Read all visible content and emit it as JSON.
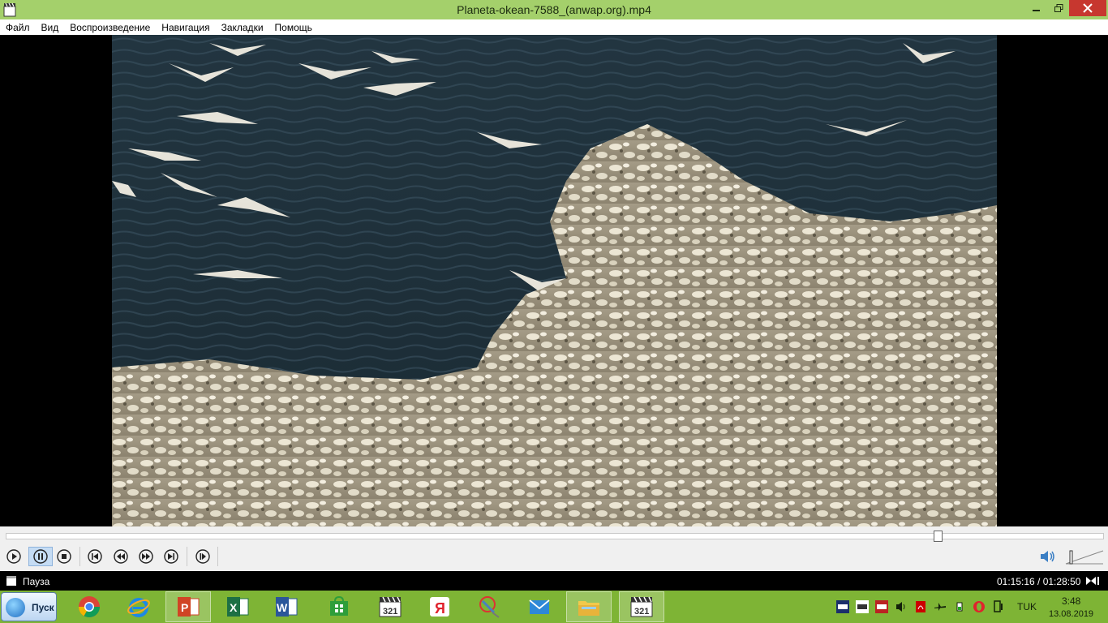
{
  "window": {
    "title": "Planeta-okean-7588_(anwap.org).mp4",
    "icon": "mpc-clapper-icon"
  },
  "menu": [
    "Файл",
    "Вид",
    "Воспроизведение",
    "Навигация",
    "Закладки",
    "Помощь"
  ],
  "video": {
    "description_icon": "video-frame",
    "seek_position": 0.85
  },
  "controls": {
    "buttons": [
      "play",
      "pause",
      "stop",
      "previous",
      "rewind",
      "forward",
      "next",
      "frame-step"
    ],
    "pressed": "pause"
  },
  "status": {
    "state": "Пауза",
    "time": "01:15:16 / 01:28:50"
  },
  "taskbar": {
    "start_label": "Пуск",
    "apps": [
      "chrome",
      "internet-explorer",
      "powerpoint",
      "excel",
      "word",
      "store",
      "media-player-classic",
      "yandex",
      "tool",
      "mail",
      "file-explorer",
      "media-player-classic-active"
    ],
    "language": "TUK",
    "clock_time": "3:48",
    "clock_date": "13.08.2019"
  },
  "colors": {
    "titlebar": "#a4d06b",
    "taskbar": "#7eb435",
    "close": "#c7372f"
  }
}
